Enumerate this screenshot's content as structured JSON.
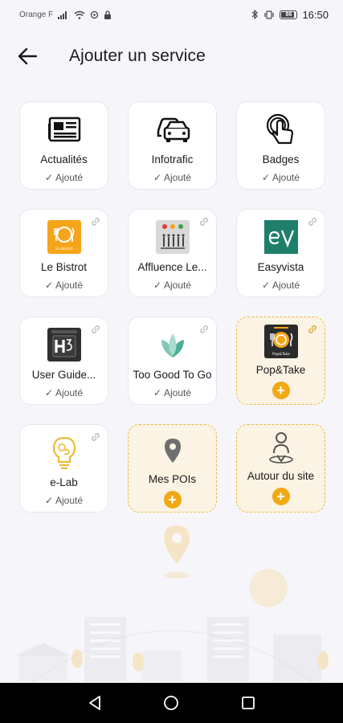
{
  "status_bar": {
    "carrier": "Orange F",
    "time": "16:50",
    "battery": "86"
  },
  "header": {
    "title": "Ajouter un service"
  },
  "colors": {
    "accent": "#f1a814",
    "dashed_border": "#f0b93a",
    "dashed_bg": "#fbf3e3"
  },
  "services": [
    {
      "name": "Actualités",
      "status": "Ajouté",
      "icon": "newspaper-icon"
    },
    {
      "name": "Infotrafic",
      "status": "Ajouté",
      "icon": "cars-icon"
    },
    {
      "name": "Badges",
      "status": "Ajouté",
      "icon": "badge-tap-icon"
    },
    {
      "name": "Le Bistrot",
      "status": "Ajouté",
      "icon": "le-bistrot-logo"
    },
    {
      "name": "Affluence Le...",
      "status": "Ajouté",
      "icon": "affluence-logo"
    },
    {
      "name": "Easyvista",
      "status": "Ajouté",
      "icon": "easyvista-logo"
    },
    {
      "name": "User Guide...",
      "status": "Ajouté",
      "icon": "user-guide-logo"
    },
    {
      "name": "Too Good To Go",
      "status": "Ajouté",
      "icon": "too-good-to-go-logo"
    },
    {
      "name": "Pop&Take",
      "icon": "pop-take-logo"
    },
    {
      "name": "e-Lab",
      "status": "Ajouté",
      "icon": "lightbulb-head-icon"
    },
    {
      "name": "Mes POIs",
      "icon": "map-pin-icon"
    },
    {
      "name": "Autour du site",
      "icon": "person-location-icon"
    }
  ]
}
